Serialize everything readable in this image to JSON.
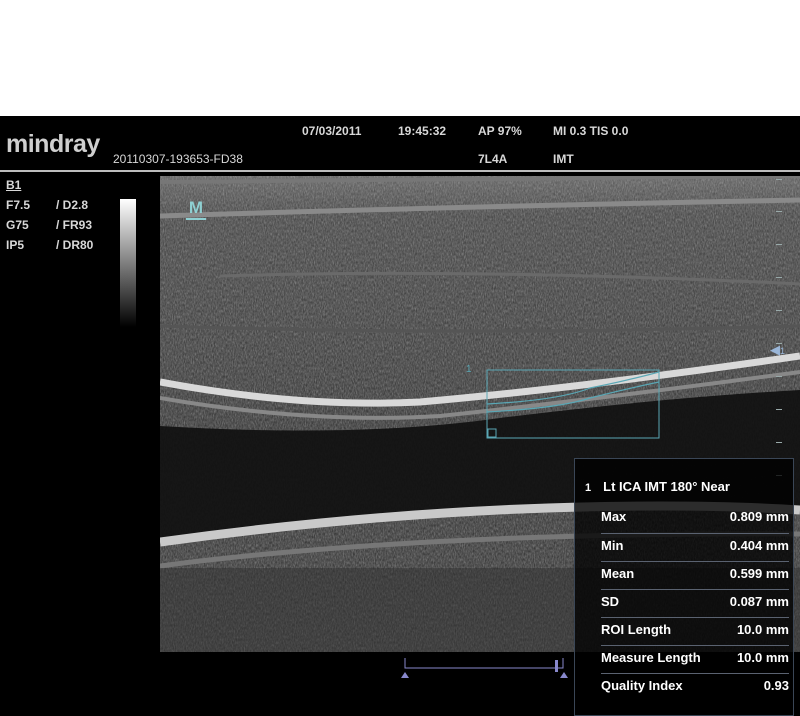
{
  "header": {
    "logo": "mindray",
    "patient_id": "20110307-193653-FD38",
    "date": "07/03/2011",
    "time": "19:45:32",
    "ap": "AP  97%",
    "mi_tis": "MI 0.3  TIS 0.0",
    "probe": "7L4A",
    "exam": "IMT"
  },
  "params": {
    "mode": "B1",
    "rows": [
      {
        "left": "F7.5",
        "right": "/ D2.8"
      },
      {
        "left": "G75",
        "right": "/ FR93"
      },
      {
        "left": "IP5",
        "right": "/ DR80"
      }
    ]
  },
  "image": {
    "roi_label": "1",
    "focus_label": "1",
    "icon": "m-mark-icon"
  },
  "results": {
    "index": "1",
    "title": "Lt ICA IMT 180° Near",
    "rows": [
      {
        "label": "Max",
        "value": "0.809 mm"
      },
      {
        "label": "Min",
        "value": "0.404 mm"
      },
      {
        "label": "Mean",
        "value": "0.599 mm"
      },
      {
        "label": "SD",
        "value": "0.087 mm"
      },
      {
        "label": "ROI Length",
        "value": "10.0 mm"
      },
      {
        "label": "Measure Length",
        "value": "10.0 mm"
      },
      {
        "label": "Quality Index",
        "value": "0.93"
      }
    ]
  },
  "colors": {
    "accent": "#8fd0d2",
    "roi_box": "#5aa7b5",
    "panel_border": "#3a4656"
  }
}
